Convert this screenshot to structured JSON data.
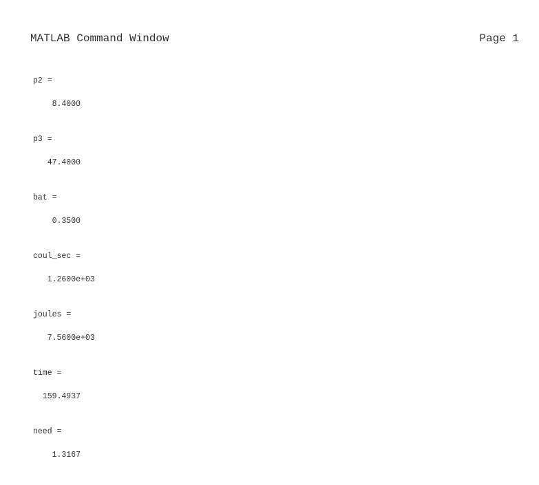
{
  "header": {
    "title": "MATLAB Command Window",
    "page": "Page 1"
  },
  "variables": [
    {
      "name": "p2 =",
      "value": "    8.4000"
    },
    {
      "name": "p3 =",
      "value": "   47.4000"
    },
    {
      "name": "bat =",
      "value": "    0.3500"
    },
    {
      "name": "coul_sec =",
      "value": "   1.2600e+03"
    },
    {
      "name": "joules =",
      "value": "   7.5600e+03"
    },
    {
      "name": "time =",
      "value": "  159.4937"
    },
    {
      "name": "need =",
      "value": "    1.3167"
    }
  ]
}
